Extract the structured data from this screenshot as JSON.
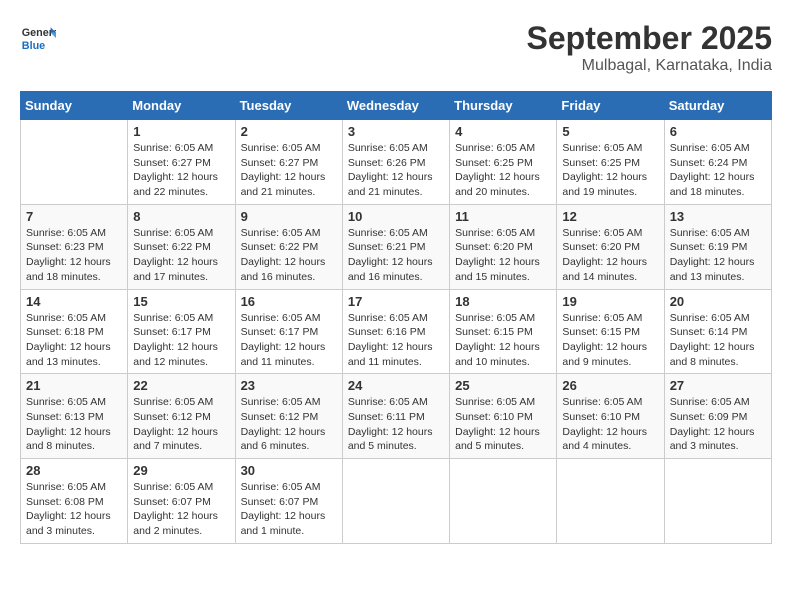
{
  "header": {
    "logo_general": "General",
    "logo_blue": "Blue",
    "month_year": "September 2025",
    "location": "Mulbagal, Karnataka, India"
  },
  "days_of_week": [
    "Sunday",
    "Monday",
    "Tuesday",
    "Wednesday",
    "Thursday",
    "Friday",
    "Saturday"
  ],
  "weeks": [
    [
      {
        "day": "",
        "sunrise": "",
        "sunset": "",
        "daylight": ""
      },
      {
        "day": "1",
        "sunrise": "Sunrise: 6:05 AM",
        "sunset": "Sunset: 6:27 PM",
        "daylight": "Daylight: 12 hours and 22 minutes."
      },
      {
        "day": "2",
        "sunrise": "Sunrise: 6:05 AM",
        "sunset": "Sunset: 6:27 PM",
        "daylight": "Daylight: 12 hours and 21 minutes."
      },
      {
        "day": "3",
        "sunrise": "Sunrise: 6:05 AM",
        "sunset": "Sunset: 6:26 PM",
        "daylight": "Daylight: 12 hours and 21 minutes."
      },
      {
        "day": "4",
        "sunrise": "Sunrise: 6:05 AM",
        "sunset": "Sunset: 6:25 PM",
        "daylight": "Daylight: 12 hours and 20 minutes."
      },
      {
        "day": "5",
        "sunrise": "Sunrise: 6:05 AM",
        "sunset": "Sunset: 6:25 PM",
        "daylight": "Daylight: 12 hours and 19 minutes."
      },
      {
        "day": "6",
        "sunrise": "Sunrise: 6:05 AM",
        "sunset": "Sunset: 6:24 PM",
        "daylight": "Daylight: 12 hours and 18 minutes."
      }
    ],
    [
      {
        "day": "7",
        "sunrise": "Sunrise: 6:05 AM",
        "sunset": "Sunset: 6:23 PM",
        "daylight": "Daylight: 12 hours and 18 minutes."
      },
      {
        "day": "8",
        "sunrise": "Sunrise: 6:05 AM",
        "sunset": "Sunset: 6:22 PM",
        "daylight": "Daylight: 12 hours and 17 minutes."
      },
      {
        "day": "9",
        "sunrise": "Sunrise: 6:05 AM",
        "sunset": "Sunset: 6:22 PM",
        "daylight": "Daylight: 12 hours and 16 minutes."
      },
      {
        "day": "10",
        "sunrise": "Sunrise: 6:05 AM",
        "sunset": "Sunset: 6:21 PM",
        "daylight": "Daylight: 12 hours and 16 minutes."
      },
      {
        "day": "11",
        "sunrise": "Sunrise: 6:05 AM",
        "sunset": "Sunset: 6:20 PM",
        "daylight": "Daylight: 12 hours and 15 minutes."
      },
      {
        "day": "12",
        "sunrise": "Sunrise: 6:05 AM",
        "sunset": "Sunset: 6:20 PM",
        "daylight": "Daylight: 12 hours and 14 minutes."
      },
      {
        "day": "13",
        "sunrise": "Sunrise: 6:05 AM",
        "sunset": "Sunset: 6:19 PM",
        "daylight": "Daylight: 12 hours and 13 minutes."
      }
    ],
    [
      {
        "day": "14",
        "sunrise": "Sunrise: 6:05 AM",
        "sunset": "Sunset: 6:18 PM",
        "daylight": "Daylight: 12 hours and 13 minutes."
      },
      {
        "day": "15",
        "sunrise": "Sunrise: 6:05 AM",
        "sunset": "Sunset: 6:17 PM",
        "daylight": "Daylight: 12 hours and 12 minutes."
      },
      {
        "day": "16",
        "sunrise": "Sunrise: 6:05 AM",
        "sunset": "Sunset: 6:17 PM",
        "daylight": "Daylight: 12 hours and 11 minutes."
      },
      {
        "day": "17",
        "sunrise": "Sunrise: 6:05 AM",
        "sunset": "Sunset: 6:16 PM",
        "daylight": "Daylight: 12 hours and 11 minutes."
      },
      {
        "day": "18",
        "sunrise": "Sunrise: 6:05 AM",
        "sunset": "Sunset: 6:15 PM",
        "daylight": "Daylight: 12 hours and 10 minutes."
      },
      {
        "day": "19",
        "sunrise": "Sunrise: 6:05 AM",
        "sunset": "Sunset: 6:15 PM",
        "daylight": "Daylight: 12 hours and 9 minutes."
      },
      {
        "day": "20",
        "sunrise": "Sunrise: 6:05 AM",
        "sunset": "Sunset: 6:14 PM",
        "daylight": "Daylight: 12 hours and 8 minutes."
      }
    ],
    [
      {
        "day": "21",
        "sunrise": "Sunrise: 6:05 AM",
        "sunset": "Sunset: 6:13 PM",
        "daylight": "Daylight: 12 hours and 8 minutes."
      },
      {
        "day": "22",
        "sunrise": "Sunrise: 6:05 AM",
        "sunset": "Sunset: 6:12 PM",
        "daylight": "Daylight: 12 hours and 7 minutes."
      },
      {
        "day": "23",
        "sunrise": "Sunrise: 6:05 AM",
        "sunset": "Sunset: 6:12 PM",
        "daylight": "Daylight: 12 hours and 6 minutes."
      },
      {
        "day": "24",
        "sunrise": "Sunrise: 6:05 AM",
        "sunset": "Sunset: 6:11 PM",
        "daylight": "Daylight: 12 hours and 5 minutes."
      },
      {
        "day": "25",
        "sunrise": "Sunrise: 6:05 AM",
        "sunset": "Sunset: 6:10 PM",
        "daylight": "Daylight: 12 hours and 5 minutes."
      },
      {
        "day": "26",
        "sunrise": "Sunrise: 6:05 AM",
        "sunset": "Sunset: 6:10 PM",
        "daylight": "Daylight: 12 hours and 4 minutes."
      },
      {
        "day": "27",
        "sunrise": "Sunrise: 6:05 AM",
        "sunset": "Sunset: 6:09 PM",
        "daylight": "Daylight: 12 hours and 3 minutes."
      }
    ],
    [
      {
        "day": "28",
        "sunrise": "Sunrise: 6:05 AM",
        "sunset": "Sunset: 6:08 PM",
        "daylight": "Daylight: 12 hours and 3 minutes."
      },
      {
        "day": "29",
        "sunrise": "Sunrise: 6:05 AM",
        "sunset": "Sunset: 6:07 PM",
        "daylight": "Daylight: 12 hours and 2 minutes."
      },
      {
        "day": "30",
        "sunrise": "Sunrise: 6:05 AM",
        "sunset": "Sunset: 6:07 PM",
        "daylight": "Daylight: 12 hours and 1 minute."
      },
      {
        "day": "",
        "sunrise": "",
        "sunset": "",
        "daylight": ""
      },
      {
        "day": "",
        "sunrise": "",
        "sunset": "",
        "daylight": ""
      },
      {
        "day": "",
        "sunrise": "",
        "sunset": "",
        "daylight": ""
      },
      {
        "day": "",
        "sunrise": "",
        "sunset": "",
        "daylight": ""
      }
    ]
  ]
}
